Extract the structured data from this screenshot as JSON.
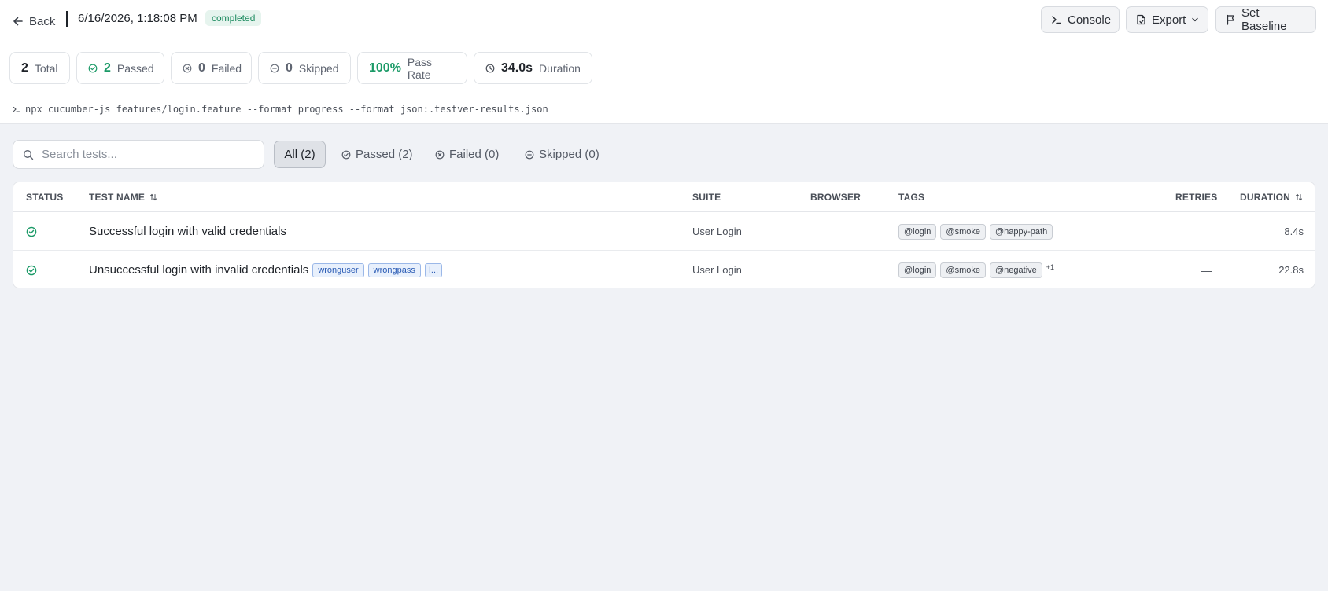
{
  "header": {
    "back_label": "Back",
    "run_date": "6/16/2026, 1:18:08 PM",
    "status": "completed",
    "console_label": "Console",
    "export_label": "Export",
    "baseline_label": "Set Baseline"
  },
  "stats": {
    "total": {
      "value": "2",
      "label": "Total"
    },
    "passed": {
      "value": "2",
      "label": "Passed"
    },
    "failed": {
      "value": "0",
      "label": "Failed"
    },
    "skipped": {
      "value": "0",
      "label": "Skipped"
    },
    "pass_rate": {
      "value": "100%",
      "label": "Pass Rate"
    },
    "duration": {
      "value": "34.0s",
      "label": "Duration"
    }
  },
  "command": "npx cucumber-js features/login.feature --format progress --format json:.testver-results.json",
  "search": {
    "placeholder": "Search tests..."
  },
  "filters": {
    "all": "All (2)",
    "passed": "Passed (2)",
    "failed": "Failed (0)",
    "skipped": "Skipped (0)"
  },
  "table": {
    "columns": {
      "status": "STATUS",
      "test_name": "TEST NAME",
      "suite": "SUITE",
      "browser": "BROWSER",
      "tags": "TAGS",
      "retries": "RETRIES",
      "duration": "DURATION"
    },
    "rows": [
      {
        "status": "passed",
        "name": "Successful login with valid credentials",
        "params": [],
        "suite": "User Login",
        "browser": "",
        "tags": [
          "@login",
          "@smoke",
          "@happy-path"
        ],
        "extra_tags": "",
        "retries": "—",
        "duration": "8.4s"
      },
      {
        "status": "passed",
        "name": "Unsuccessful login with invalid credentials",
        "params": [
          "wronguser",
          "wrongpass",
          "I..."
        ],
        "suite": "User Login",
        "browser": "",
        "tags": [
          "@login",
          "@smoke",
          "@negative"
        ],
        "extra_tags": "+1",
        "retries": "—",
        "duration": "22.8s"
      }
    ]
  },
  "colors": {
    "accent_green": "#1b9a67",
    "badge_bg": "#e6f4ee",
    "param_blue": "#2a5bb4",
    "page_bg": "#f0f2f6"
  }
}
